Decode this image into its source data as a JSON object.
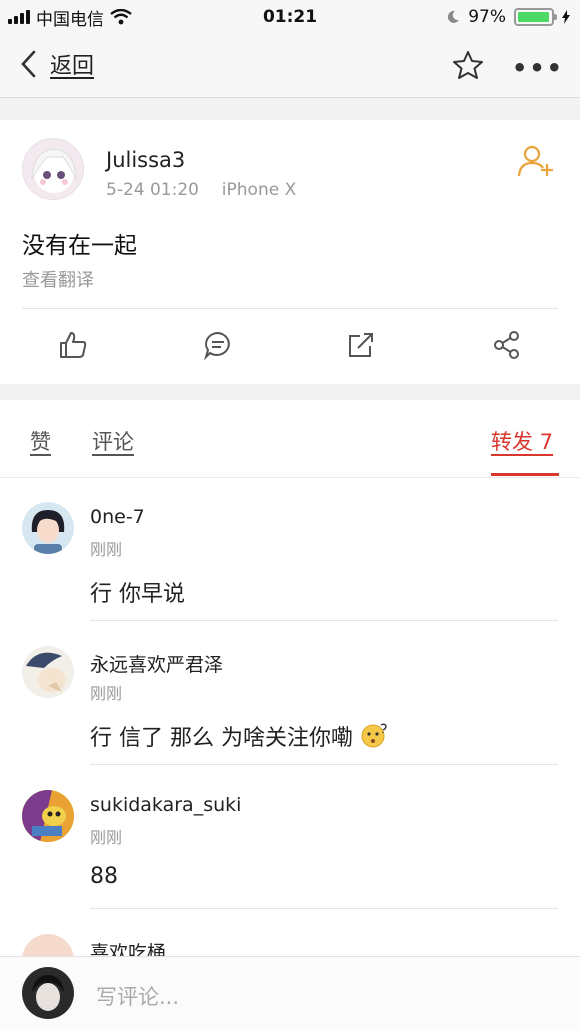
{
  "status_bar": {
    "carrier": "中国电信",
    "time": "01:21",
    "battery_percent": "97%",
    "battery_level": 0.97
  },
  "nav": {
    "back_label": "返回"
  },
  "post": {
    "author": "Julissa3",
    "timestamp": "5-24 01:20",
    "device": "iPhone X",
    "text": "没有在一起",
    "translate_label": "查看翻译"
  },
  "tabs": {
    "likes": "赞",
    "comments": "评论",
    "reposts": "转发 7"
  },
  "comments": [
    {
      "name": "0ne-7",
      "time": "刚刚",
      "text": "行 你早说"
    },
    {
      "name": "永远喜欢严君泽",
      "time": "刚刚",
      "text": "行 信了 那么 为啥关注你嘞"
    },
    {
      "name": "sukidakara_suki",
      "time": "刚刚",
      "text": "88"
    },
    {
      "name": "喜欢吃桶"
    }
  ],
  "composer": {
    "placeholder": "写评论..."
  },
  "colors": {
    "accent": "#d9372d",
    "follow": "#e8a33a",
    "battery": "#4cd964"
  }
}
